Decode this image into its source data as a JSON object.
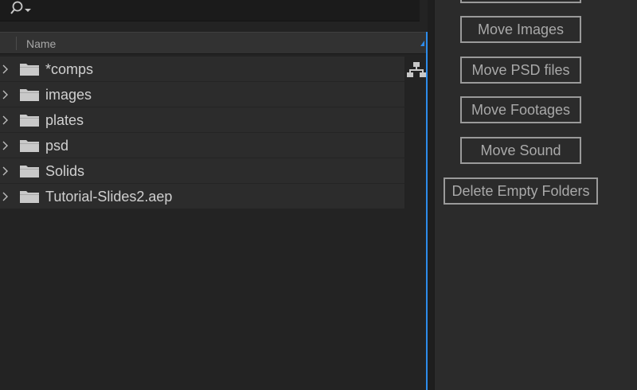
{
  "project_panel": {
    "search": {
      "icon": "search-dropdown-icon"
    },
    "column_header": {
      "name_label": "Name",
      "sort_icon": "sort-indicator-icon"
    },
    "items": [
      {
        "label": "*comps",
        "icon": "folder-icon",
        "expand_icon": "chevron-right-icon"
      },
      {
        "label": "images",
        "icon": "folder-icon",
        "expand_icon": "chevron-right-icon"
      },
      {
        "label": "plates",
        "icon": "folder-icon",
        "expand_icon": "chevron-right-icon"
      },
      {
        "label": "psd",
        "icon": "folder-icon",
        "expand_icon": "chevron-right-icon"
      },
      {
        "label": "Solids",
        "icon": "folder-icon",
        "expand_icon": "chevron-right-icon"
      },
      {
        "label": "Tutorial-Slides2.aep",
        "icon": "folder-icon",
        "expand_icon": "chevron-right-icon"
      }
    ],
    "flowchart_icon": "flowchart-icon"
  },
  "actions": {
    "move_images": "Move Images",
    "move_psd": "Move PSD files",
    "move_footages": "Move Footages",
    "move_sound": "Move Sound",
    "delete_empty": "Delete Empty Folders"
  },
  "colors": {
    "accent": "#2d8ceb",
    "panel_bg": "#232323",
    "row_bg": "#2c2c2c",
    "button_border": "#9a9a9a"
  }
}
